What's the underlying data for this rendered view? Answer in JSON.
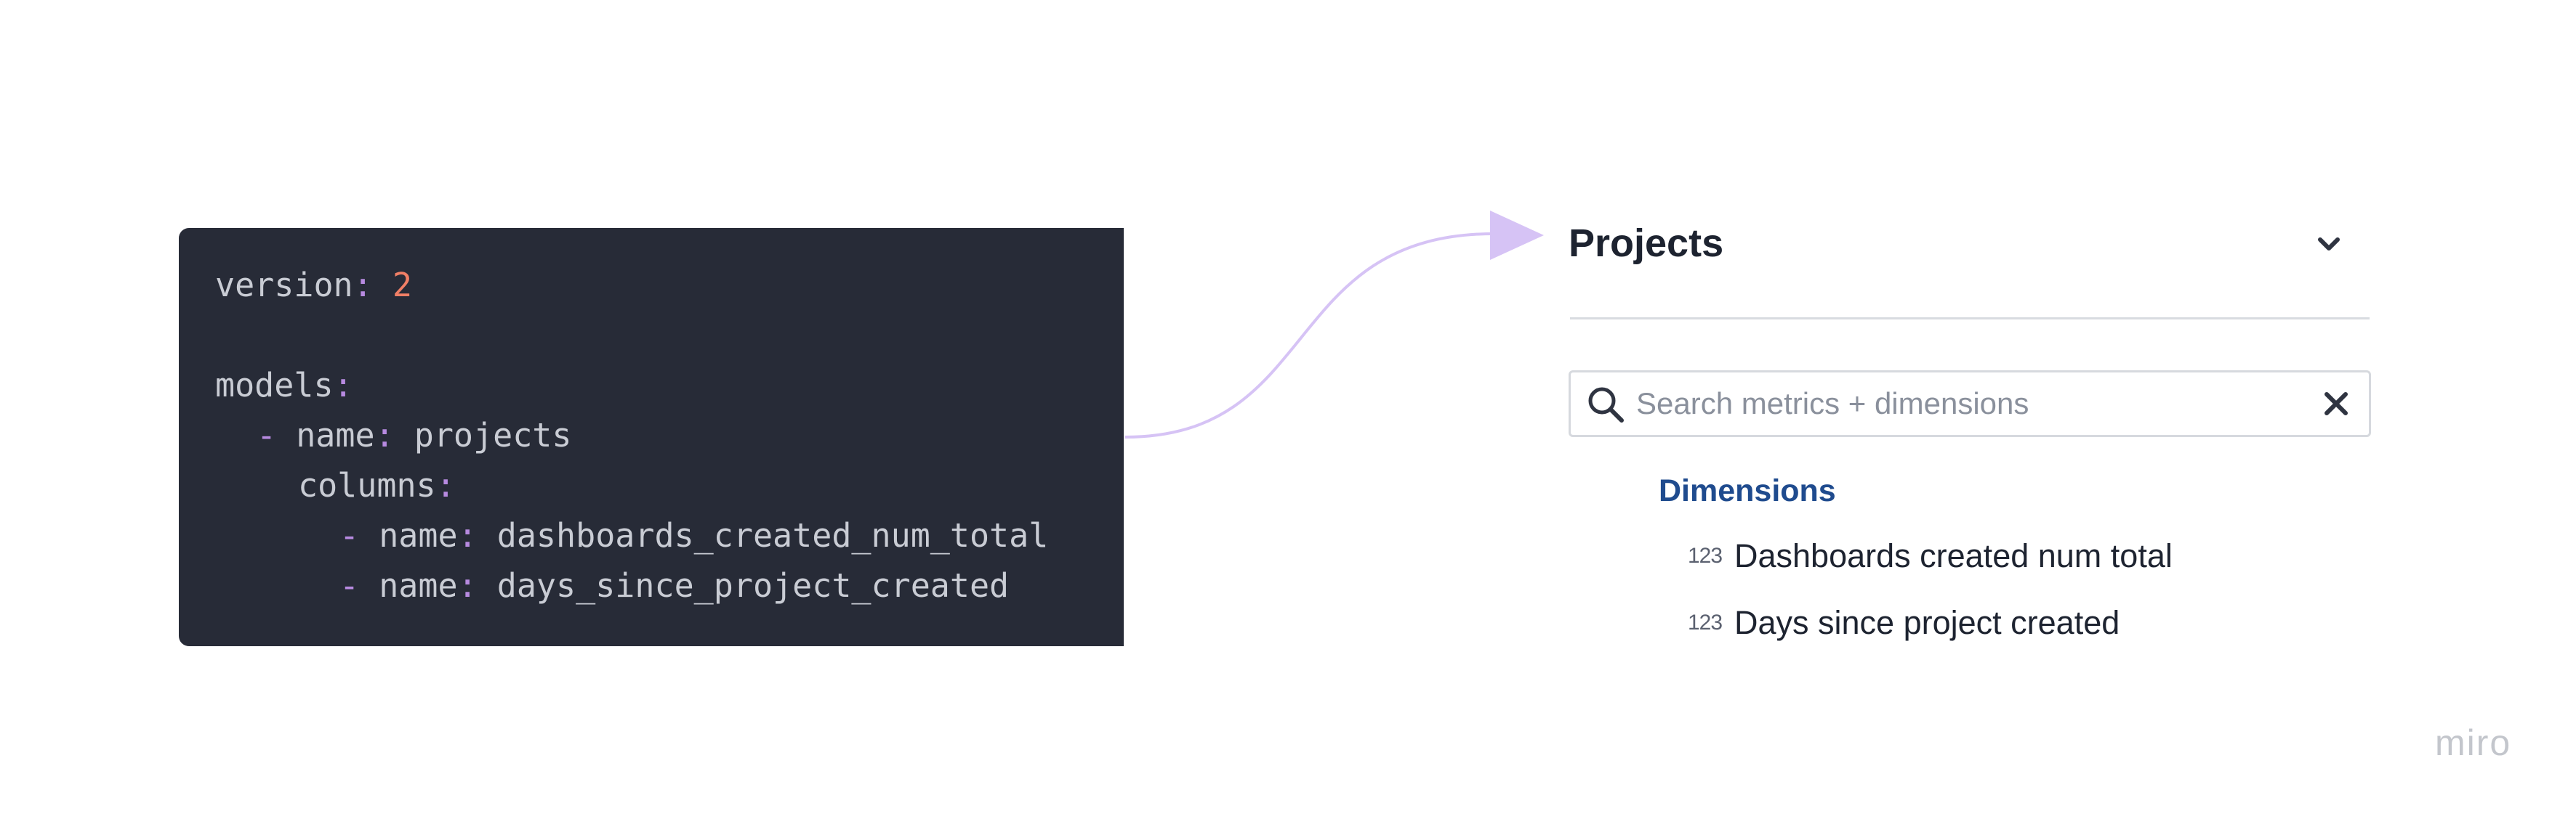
{
  "code": {
    "lines": [
      {
        "key": "version",
        "colon": ":",
        "value": "2"
      },
      {
        "blank": ""
      },
      {
        "key": "models",
        "colon": ":"
      },
      {
        "dash": "-",
        "key": "name",
        "colon": ":",
        "value": "projects"
      },
      {
        "key": "columns",
        "colon": ":"
      },
      {
        "dash": "-",
        "key": "name",
        "colon": ":",
        "value": "dashboards_created_num_total"
      },
      {
        "dash": "-",
        "key": "name",
        "colon": ":",
        "value": "days_since_project_created"
      }
    ]
  },
  "panel": {
    "title": "Projects",
    "search": {
      "placeholder": "Search metrics + dimensions",
      "value": ""
    },
    "section_header": "Dimensions",
    "fields": [
      {
        "type_icon": "123",
        "label": "Dashboards created num total"
      },
      {
        "type_icon": "123",
        "label": "Days since project created"
      }
    ]
  },
  "watermark": "miro",
  "colors": {
    "code_bg": "#272b37",
    "code_text": "#c9ccd4",
    "code_punct": "#b78ae0",
    "code_number": "#f07f66",
    "connector": "#d6c3f5",
    "section_header": "#1f4b8e"
  },
  "icons": [
    "chevron-down-icon",
    "search-icon",
    "close-icon",
    "number-type-icon"
  ]
}
